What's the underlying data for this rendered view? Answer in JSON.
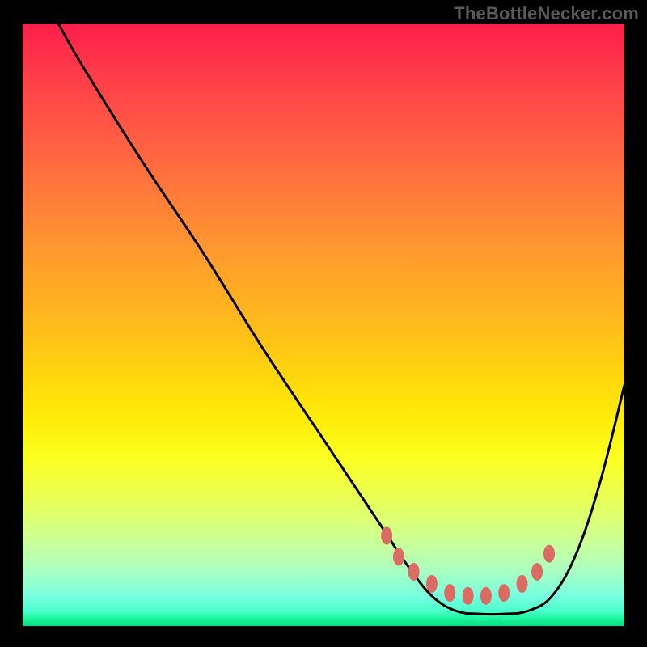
{
  "attribution": "TheBottleNecker.com",
  "chart_data": {
    "type": "line",
    "title": "",
    "xlabel": "",
    "ylabel": "",
    "xlim": [
      0,
      100
    ],
    "ylim": [
      0,
      100
    ],
    "series": [
      {
        "name": "curve",
        "x": [
          6,
          10,
          20,
          30,
          40,
          50,
          56,
          60,
          64,
          68,
          72,
          76,
          80,
          84,
          88,
          92,
          96,
          100
        ],
        "y": [
          100,
          93,
          77,
          62,
          46,
          31,
          22,
          16,
          10,
          5,
          2.5,
          2,
          2,
          2.5,
          5,
          12,
          24,
          40
        ]
      }
    ],
    "markers": {
      "name": "highlight-dots",
      "color": "#dc6b63",
      "points": [
        {
          "x": 60.5,
          "y": 15
        },
        {
          "x": 62.5,
          "y": 11.5
        },
        {
          "x": 65,
          "y": 9
        },
        {
          "x": 68,
          "y": 7
        },
        {
          "x": 71,
          "y": 5.5
        },
        {
          "x": 74,
          "y": 5
        },
        {
          "x": 77,
          "y": 5
        },
        {
          "x": 80,
          "y": 5.5
        },
        {
          "x": 83,
          "y": 7
        },
        {
          "x": 85.5,
          "y": 9
        },
        {
          "x": 87.5,
          "y": 12
        }
      ]
    },
    "gradient_stops": [
      {
        "pos": 0,
        "color": "#ff1e4a"
      },
      {
        "pos": 50,
        "color": "#ffd40e"
      },
      {
        "pos": 100,
        "color": "#0bd97e"
      }
    ]
  }
}
